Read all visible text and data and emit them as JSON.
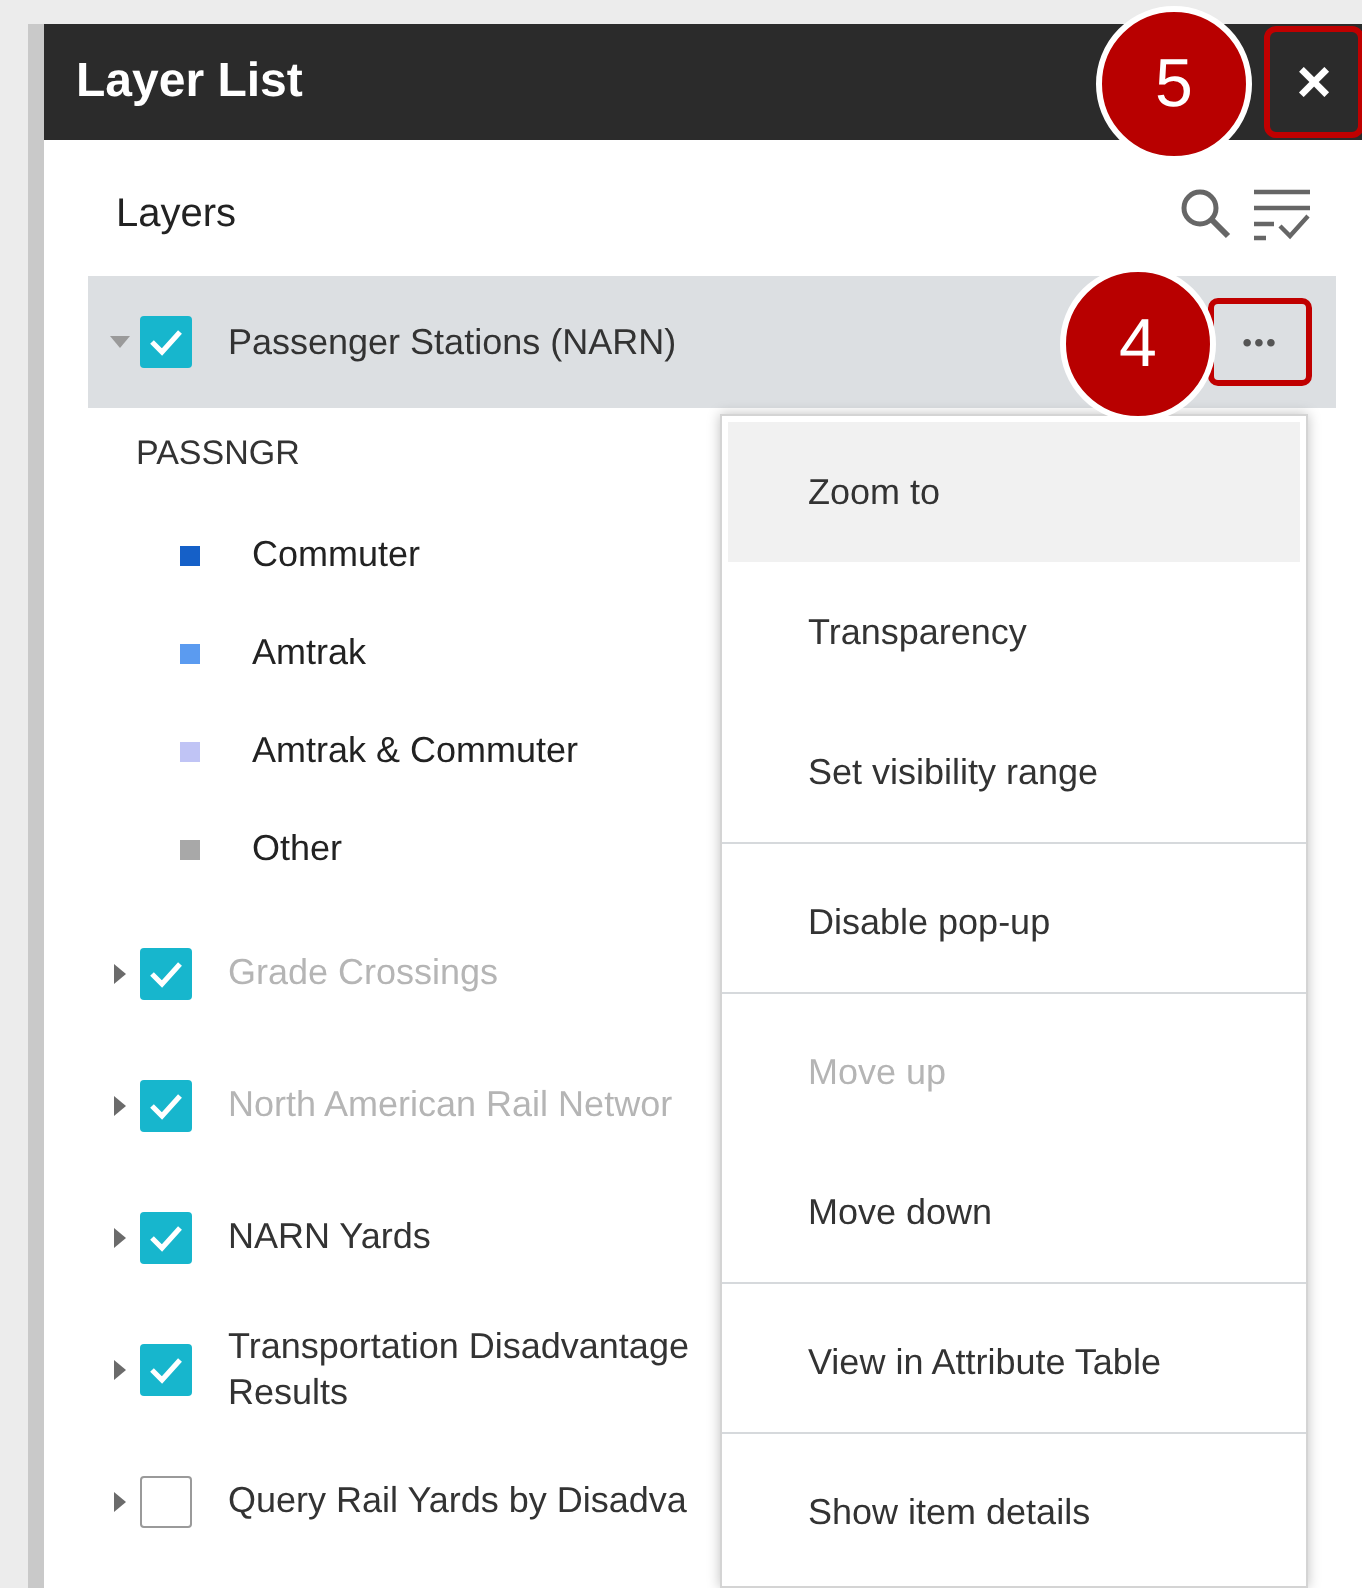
{
  "panel": {
    "title": "Layer List",
    "close": "×",
    "callout": "5"
  },
  "section": {
    "title": "Layers"
  },
  "layers": [
    {
      "name": "Passenger Stations (NARN)",
      "checked": true,
      "expanded": true,
      "dimmed": false,
      "selected": true,
      "more": "•••",
      "callout": "4",
      "legend": {
        "field": "PASSNGR",
        "classes": [
          {
            "label": "Commuter",
            "color": "#1560c8"
          },
          {
            "label": "Amtrak",
            "color": "#5b9bf0"
          },
          {
            "label": "Amtrak & Commuter",
            "color": "#c0c4f5"
          },
          {
            "label": "Other",
            "color": "#a8a8a8"
          }
        ]
      }
    },
    {
      "name": "Grade Crossings",
      "checked": true,
      "expanded": false,
      "dimmed": true,
      "selected": false
    },
    {
      "name": "North American Rail Networ",
      "checked": true,
      "expanded": false,
      "dimmed": true,
      "selected": false
    },
    {
      "name": "NARN Yards",
      "checked": true,
      "expanded": false,
      "dimmed": false,
      "selected": false
    },
    {
      "name": "Transportation Disadvantage\nResults",
      "checked": true,
      "expanded": false,
      "dimmed": false,
      "selected": false
    },
    {
      "name": "Query Rail Yards by Disadva",
      "checked": false,
      "expanded": false,
      "dimmed": false,
      "selected": false
    }
  ],
  "menu": [
    [
      {
        "label": "Zoom to",
        "selected": true,
        "disabled": false
      },
      {
        "label": "Transparency",
        "selected": false,
        "disabled": false
      },
      {
        "label": "Set visibility range",
        "selected": false,
        "disabled": false
      }
    ],
    [
      {
        "label": "Disable pop-up",
        "selected": false,
        "disabled": false
      }
    ],
    [
      {
        "label": "Move up",
        "selected": false,
        "disabled": true
      },
      {
        "label": "Move down",
        "selected": false,
        "disabled": false
      }
    ],
    [
      {
        "label": "View in Attribute Table",
        "selected": false,
        "disabled": false
      }
    ],
    [
      {
        "label": "Show item details",
        "selected": false,
        "disabled": false
      }
    ]
  ]
}
